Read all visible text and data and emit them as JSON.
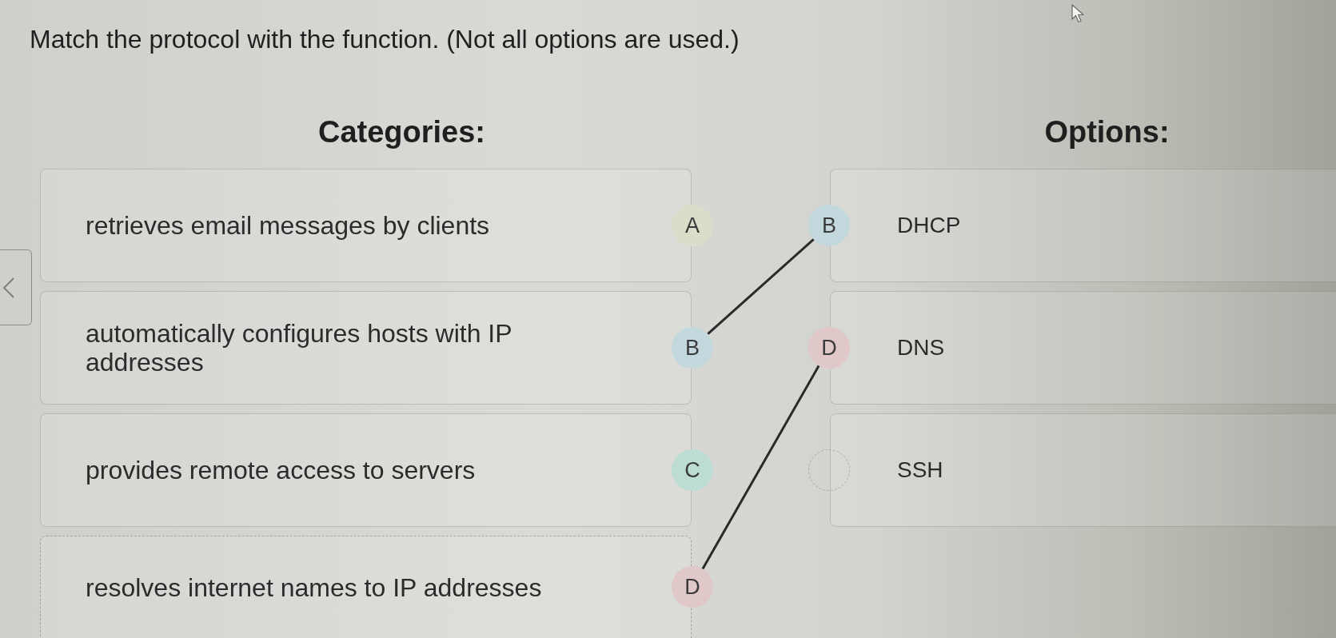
{
  "question": "Match the protocol with the function. (Not all options are used.)",
  "categories": {
    "heading": "Categories:",
    "items": [
      {
        "text": "retrieves email messages by clients",
        "letter": "A",
        "color": "#dcdccb",
        "connected": false,
        "focused": false
      },
      {
        "text": "automatically configures hosts with IP addresses",
        "letter": "B",
        "color": "#c3d8dc",
        "connected": true,
        "focused": false
      },
      {
        "text": "provides remote access to servers",
        "letter": "C",
        "color": "#bddcd3",
        "connected": false,
        "focused": false
      },
      {
        "text": "resolves internet names to IP addresses",
        "letter": "D",
        "color": "#e0c7c8",
        "connected": true,
        "focused": true
      }
    ]
  },
  "options": {
    "heading": "Options:",
    "items": [
      {
        "text": "DHCP",
        "letter": "B",
        "color": "#c3d8dc",
        "connected": true
      },
      {
        "text": "DNS",
        "letter": "D",
        "color": "#e0c7c8",
        "connected": true
      },
      {
        "text": "SSH",
        "connected": false
      }
    ]
  }
}
